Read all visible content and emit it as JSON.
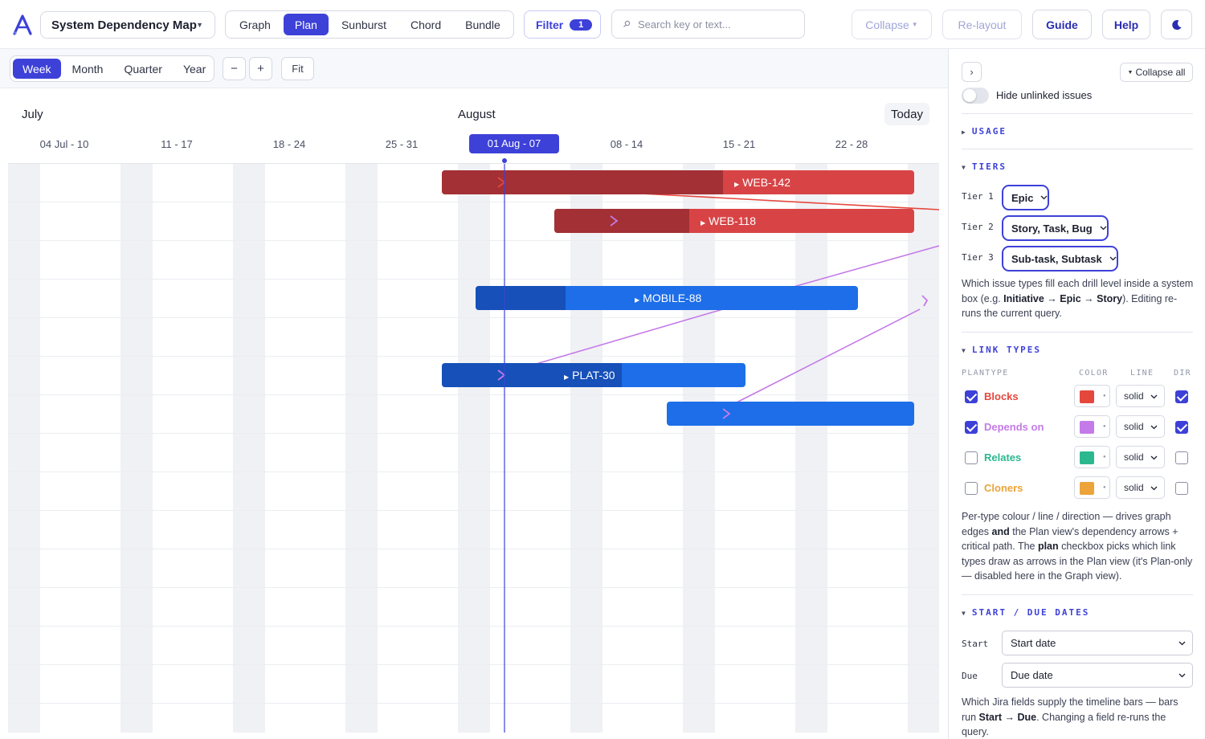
{
  "header": {
    "project": "System Dependency Map",
    "views": [
      "Graph",
      "Plan",
      "Sunburst",
      "Chord",
      "Bundle"
    ],
    "active_view": "Plan",
    "filter_label": "Filter",
    "filter_count": "1",
    "search_placeholder": "Search key or text...",
    "collapse_label": "Collapse",
    "relayout_label": "Re-layout",
    "guide_label": "Guide",
    "help_label": "Help"
  },
  "toolbar": {
    "zoom_levels": [
      "Week",
      "Month",
      "Quarter",
      "Year"
    ],
    "active_zoom": "Week",
    "zoom_out": "−",
    "zoom_in": "+",
    "fit": "Fit"
  },
  "timeline": {
    "months": [
      "July",
      "August"
    ],
    "today_label": "Today",
    "weeks": [
      "04 Jul - 10",
      "11 - 17",
      "18 - 24",
      "25 - 31",
      "01 Aug - 07",
      "08 - 14",
      "15 - 21",
      "22 - 28"
    ],
    "current_week_index": 4,
    "bars": [
      {
        "key": "WEB-142",
        "color": "red",
        "row": 0,
        "start_week": 4.0,
        "end_week": 8.2,
        "progress_end_week": 6.5
      },
      {
        "key": "WEB-118",
        "color": "red",
        "row": 1,
        "start_week": 5.0,
        "end_week": 8.2,
        "progress_end_week": 6.2
      },
      {
        "key": "MOBILE-88",
        "color": "blue",
        "row": 3,
        "start_week": 4.3,
        "end_week": 7.7,
        "progress_end_week": 5.1
      },
      {
        "key": "PLAT-30",
        "color": "blue",
        "row": 5,
        "start_week": 4.0,
        "end_week": 6.7,
        "progress_end_week": 5.6
      },
      {
        "key": "",
        "color": "blue",
        "row": 6,
        "start_week": 6.0,
        "end_week": 8.2,
        "progress_end_week": 6.0
      }
    ]
  },
  "panel": {
    "collapse_all": "Collapse all",
    "hide_unlinked": "Hide unlinked issues",
    "sections": {
      "usage": "USAGE",
      "tiers": "TIERS",
      "link_types": "LINK TYPES",
      "dates": "START / DUE DATES"
    },
    "tiers": [
      {
        "label": "Tier 1",
        "value": "Epic"
      },
      {
        "label": "Tier 2",
        "value": "Story, Task, Bug"
      },
      {
        "label": "Tier 3",
        "value": "Sub-task, Subtask"
      }
    ],
    "tiers_help": {
      "a": "Which issue types fill each drill level inside a system box (e.g. ",
      "b": "Initiative → Epic → Story",
      "c": "). Editing re-runs the current query."
    },
    "link_headers": {
      "plantype": "PLANTYPE",
      "color": "COLOR",
      "line": "LINE",
      "dir": "DIR"
    },
    "link_types": [
      {
        "name": "Blocks",
        "color": "#e5473d",
        "line": "solid",
        "plan": true,
        "dir": true
      },
      {
        "name": "Depends on",
        "color": "#c47ae8",
        "line": "solid",
        "plan": true,
        "dir": true
      },
      {
        "name": "Relates",
        "color": "#2bb88f",
        "line": "solid",
        "plan": false,
        "dir": false
      },
      {
        "name": "Cloners",
        "color": "#eba33a",
        "line": "solid",
        "plan": false,
        "dir": false
      }
    ],
    "link_help": {
      "a": "Per-type colour / line / direction — drives graph edges ",
      "b": "and",
      "c": " the Plan view's dependency arrows + critical path. The ",
      "d": "plan",
      "e": " checkbox picks which link types draw as arrows in the Plan view (it's Plan-only — disabled here in the Graph view)."
    },
    "dates": [
      {
        "label": "Start",
        "value": "Start date"
      },
      {
        "label": "Due",
        "value": "Due date"
      }
    ],
    "dates_help": {
      "a": "Which Jira fields supply the timeline bars — bars run ",
      "b": "Start → Due",
      "c": ". Changing a field re-runs the query."
    }
  },
  "colors": {
    "accent": "#3d41d8",
    "blocks": "#e5473d",
    "depends": "#c47ae8",
    "bar_red": "#d84446",
    "bar_blue": "#1d6ee8"
  }
}
